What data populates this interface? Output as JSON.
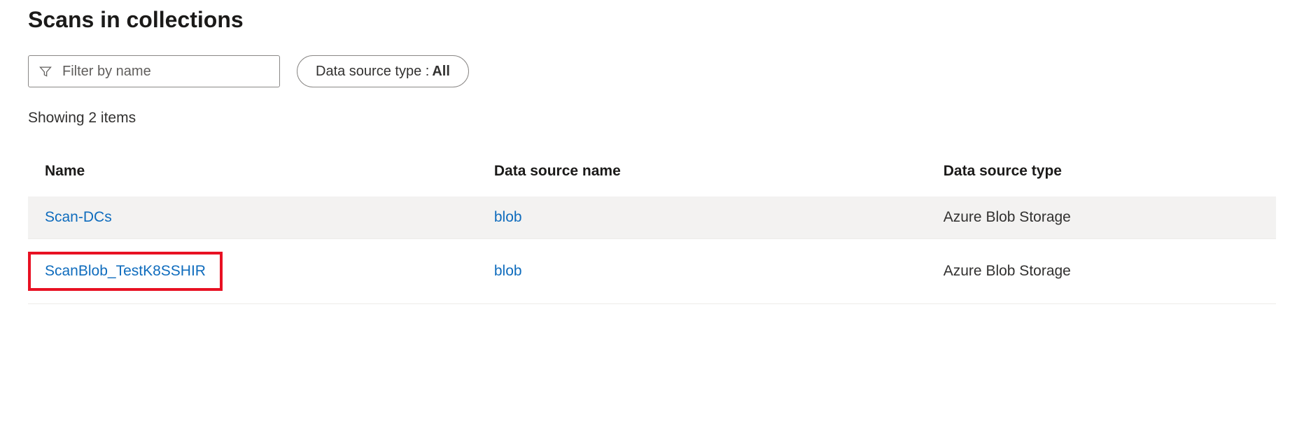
{
  "header": {
    "title": "Scans in collections"
  },
  "filters": {
    "name_placeholder": "Filter by name",
    "type_label": "Data source type :",
    "type_value": "All"
  },
  "status": {
    "showing": "Showing 2 items"
  },
  "table": {
    "columns": {
      "name": "Name",
      "source_name": "Data source name",
      "source_type": "Data source type"
    },
    "rows": [
      {
        "name": "Scan-DCs",
        "source_name": "blob",
        "source_type": "Azure Blob Storage",
        "highlighted": false
      },
      {
        "name": "ScanBlob_TestK8SSHIR",
        "source_name": "blob",
        "source_type": "Azure Blob Storage",
        "highlighted": true
      }
    ]
  },
  "colors": {
    "link": "#0f6cbd",
    "highlight": "#e81123"
  }
}
